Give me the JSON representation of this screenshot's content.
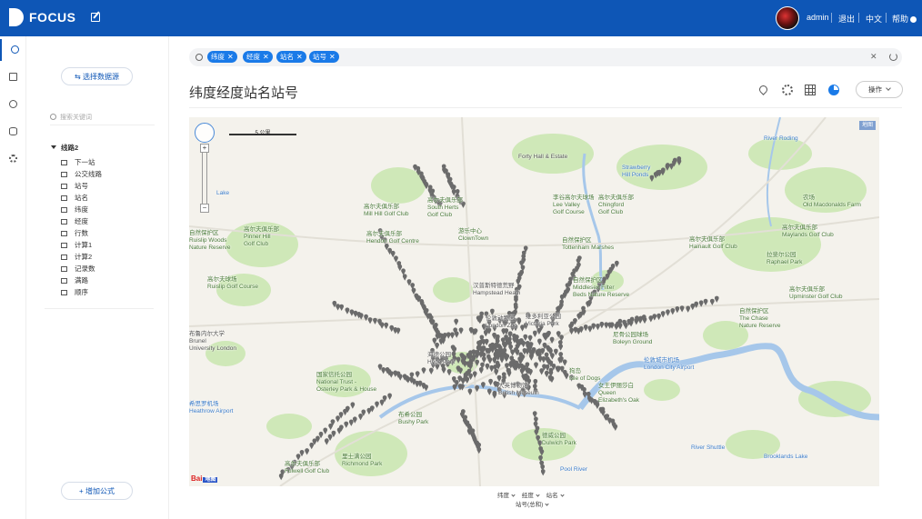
{
  "app": {
    "logo_text": "FOCUS"
  },
  "topbar": {
    "username": "admin",
    "logout": "退出",
    "language": "中文",
    "help": "帮助"
  },
  "panel": {
    "select_source_button": "⇆ 选择数据源",
    "search_placeholder": "搜索关键词",
    "tree_root": "线路2",
    "fields": [
      "下一站",
      "公交线路",
      "站号",
      "站名",
      "纬度",
      "经度",
      "行数",
      "计算1",
      "计算2",
      "记录数",
      "满路",
      "顺序"
    ],
    "add_formula_button": "+ 增加公式"
  },
  "filter": {
    "chips": [
      "纬度",
      "经度",
      "站名",
      "站号"
    ]
  },
  "main": {
    "title": "纬度经度站名站号",
    "ops_button": "操作"
  },
  "map": {
    "scale_label": "5 公里",
    "badge": "地图",
    "baidu": "Bai",
    "baidu_suffix": "地图",
    "labels": {
      "forty_hall": "Forty Hall & Estate",
      "lee_valley": "李谷高尔夫球场\nLee Valley\nGolf Course",
      "chingford": "高尔夫俱乐部\nChingford\nGolf Club",
      "mill_hill": "高尔夫俱乐部\nMill Hill Golf Club",
      "south_herts": "高尔夫俱乐部\nSouth Herts\nGolf Club",
      "pinner": "高尔夫俱乐部\nPinner Hill\nGolf Club",
      "ruislip_woods": "自然保护区\nRuislip Woods\nNature Reserve",
      "ruislip_golf": "高尔夫球场\nRuislip Golf Course",
      "hendon": "高尔夫俱乐部\nHendon Golf Centre",
      "clowntown": "游乐中心\nClownTown",
      "tottenham": "自然保护区\nTottenham Marshes",
      "middlesex": "自然保护区\nMiddlesex Filter\nBeds Nature Reserve",
      "hainault": "高尔夫俱乐部\nHainault Golf Club",
      "old_macdonalds": "农场\nOld Macdonalds Farm",
      "maylands": "高尔夫俱乐部\nMaylands Golf Club",
      "raphael": "拉斐尔公园\nRaphael Park",
      "upminster": "高尔夫俱乐部\nUpminster Golf Club",
      "the_chase": "自然保护区\nThe Chase\nNature Reserve",
      "hampstead": "汉普斯特德荒野\nHampstead Heath",
      "victoria_park": "维多利亚公园\nVictoria Park",
      "london_zoo": "伦敦动物园\nLondon Zoo",
      "boleyn": "尼骨公园球场\nBoleyn Ground",
      "brunel": "布鲁内尔大学\nBrunel\nUniversity London",
      "city_airport": "伦敦城市机场\nLondon City Airport",
      "isle_of_dogs": "狗岛\nIsle of Dogs",
      "osterley": "国家信托公园\nNational Trust -\nOsterley Park & House",
      "hyde_park": "海德公园\nHyde Park",
      "british_museum": "大英博物馆\nBritish Museum",
      "queen_elizabeth": "女王伊丽莎白\nQueen\nElizabeth's Oak",
      "heathrow": "希思罗机场\nHeathrow Airport",
      "bushy": "布希公园\nBushy Park",
      "richmond": "里士满公园\nRichmond Park",
      "dulwich": "德威公园\nDulwich Park",
      "fulwell": "高尔夫俱乐部\nFulwell Golf Club",
      "pool_river": "Pool River",
      "river_roding": "River Roding",
      "river_shuttle": "River Shuttle",
      "brooklands_lake": "Brooklands Lake",
      "strawberry": "Strawberry\nHill Ponds",
      "ruislip_lake": "Lake"
    }
  },
  "bottom": {
    "fields": [
      "纬度",
      "经度",
      "站名"
    ],
    "second_row": "站号(总和)"
  },
  "colors": {
    "brand": "#0e56b6",
    "chip": "#1a7ae8",
    "marker": "#6b6b6b",
    "river": "#a6c7ea",
    "park": "#cfe8b8"
  }
}
